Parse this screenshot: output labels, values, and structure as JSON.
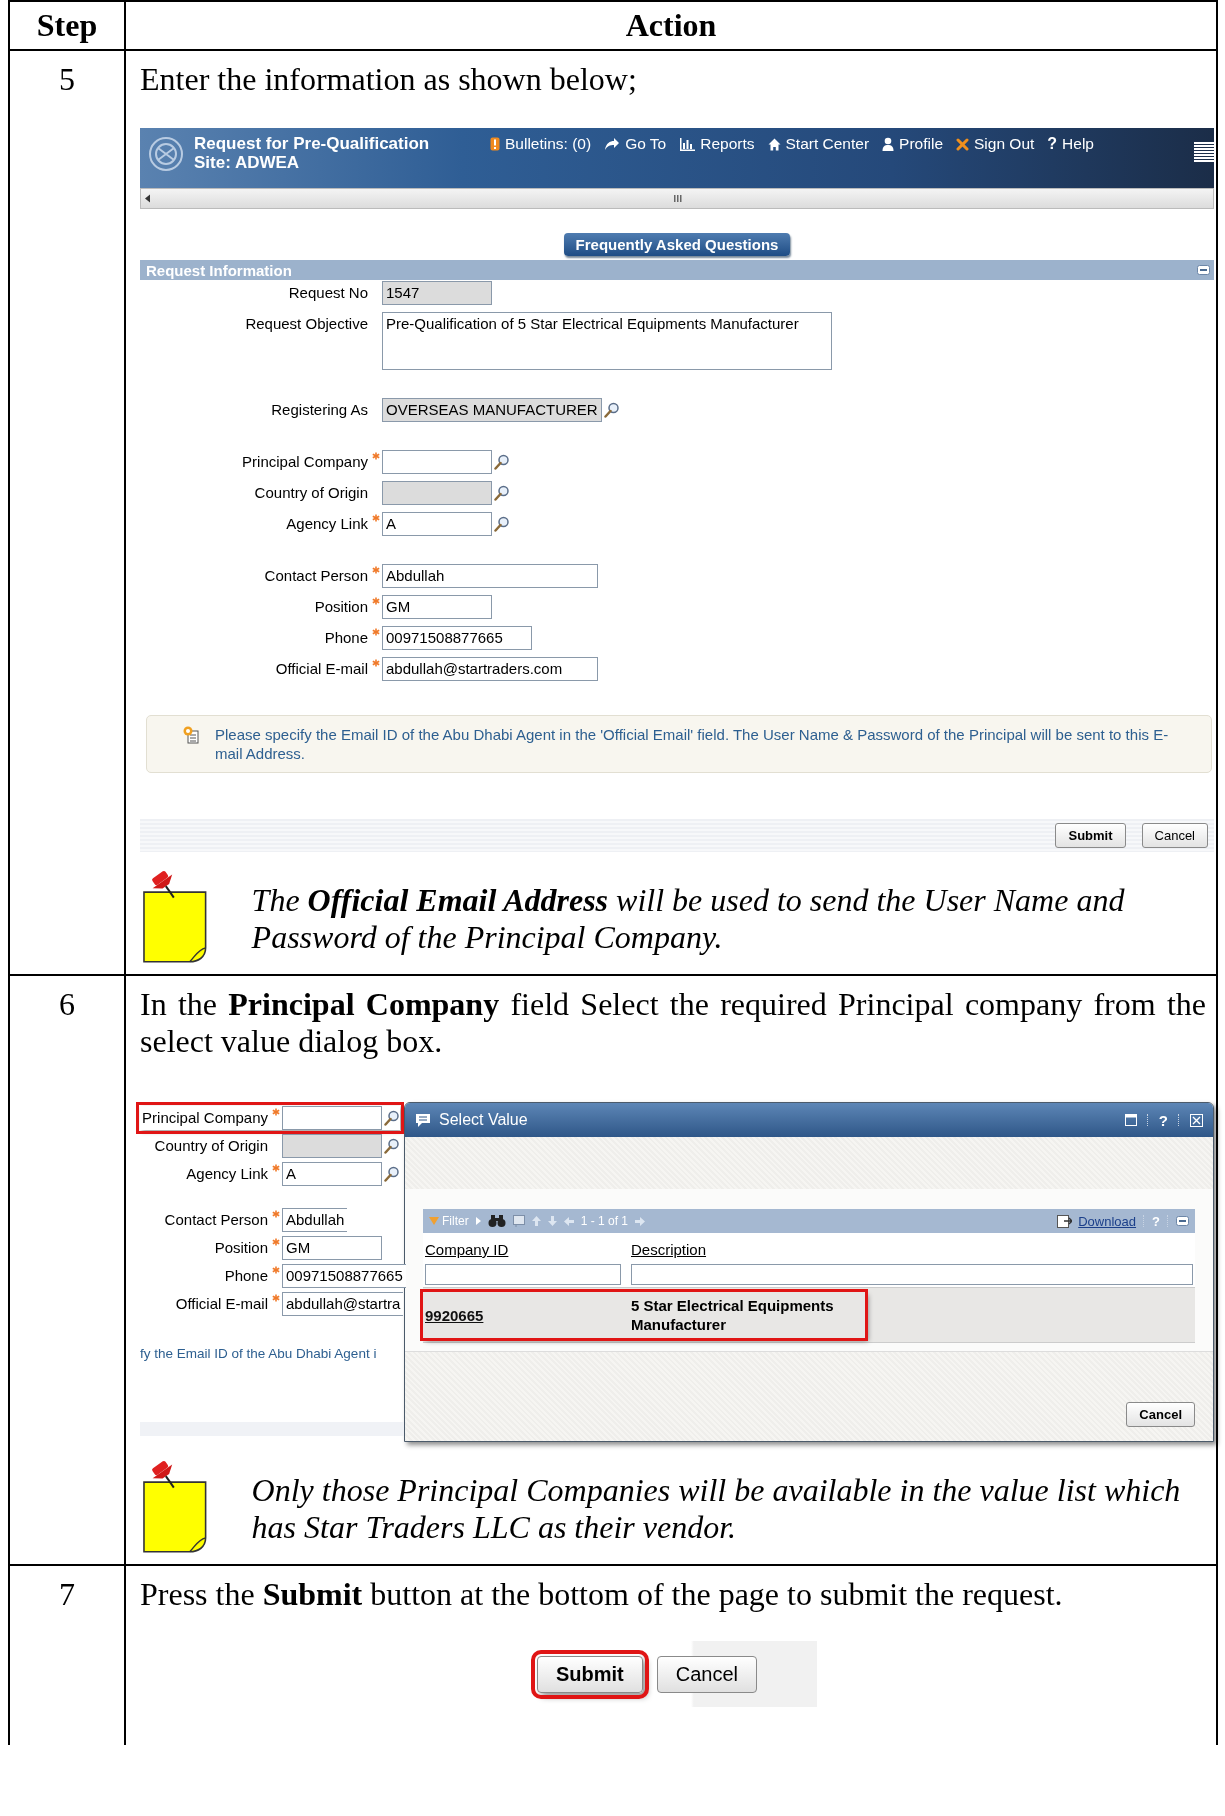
{
  "columns": [
    "Step",
    "Action"
  ],
  "steps": [
    {
      "number": "5",
      "instruction": "Enter the information as shown below;",
      "screenshot": {
        "kind": "form",
        "app_bar": {
          "title": "Request for Pre-Qualification",
          "site": "Site: ADWEA",
          "links": [
            {
              "label": "Bulletins: (0)"
            },
            {
              "label": "Go To"
            },
            {
              "label": "Reports"
            },
            {
              "label": "Start Center"
            },
            {
              "label": "Profile"
            },
            {
              "label": "Sign Out"
            },
            {
              "label": "Help",
              "glyph": "?"
            }
          ]
        },
        "faq_button": "Frequently Asked Questions",
        "section_title": "Request Information",
        "field_groups": [
          [
            {
              "label": "Request No",
              "value": "1547",
              "kind": "readonly",
              "required": false,
              "lookup": false
            },
            {
              "label": "Request Objective",
              "value": "Pre-Qualification of 5 Star Electrical Equipments Manufacturer",
              "kind": "textarea",
              "required": false,
              "lookup": false
            }
          ],
          [
            {
              "label": "Registering As",
              "value": "OVERSEAS MANUFACTURER",
              "kind": "readonly",
              "required": false,
              "lookup": true
            }
          ],
          [
            {
              "label": "Principal Company",
              "kind": "text",
              "required": true,
              "lookup": true
            },
            {
              "label": "Country of Origin",
              "kind": "readonly",
              "required": false,
              "lookup": true
            },
            {
              "label": "Agency Link",
              "value": "A",
              "kind": "text",
              "required": true,
              "lookup": true
            }
          ],
          [
            {
              "label": "Contact Person",
              "value": "Abdullah",
              "kind": "text",
              "required": true,
              "lookup": false
            },
            {
              "label": "Position",
              "value": "GM",
              "kind": "text",
              "required": true,
              "lookup": false
            },
            {
              "label": "Phone",
              "value": "00971508877665",
              "kind": "text",
              "required": true,
              "lookup": false
            },
            {
              "label": "Official E-mail",
              "value": "abdullah@startraders.com",
              "kind": "text",
              "required": true,
              "lookup": false
            }
          ]
        ],
        "info_message": "Please specify the Email ID of the Abu Dhabi Agent in the 'Official Email' field. The User Name & Password of the Principal will be sent to this E-mail Address.",
        "buttons": [
          "Submit",
          "Cancel"
        ]
      },
      "note": "The **Official Email Address** will be used to send the User Name and Password of the Principal Company."
    },
    {
      "number": "6",
      "instruction": "In the **Principal Company** field Select the required Principal company from the select value dialog box.",
      "screenshot": {
        "kind": "lookup",
        "background_fields": [
          {
            "label": "Principal Company",
            "kind": "text",
            "required": true,
            "lookup": true,
            "highlighted": true
          },
          {
            "label": "Country of Origin",
            "kind": "readonly",
            "required": false,
            "lookup": true,
            "highlighted": false
          },
          {
            "label": "Agency Link",
            "value": "A",
            "kind": "text",
            "required": true,
            "lookup": true,
            "highlighted": false
          },
          {
            "label": "Contact Person",
            "value": "Abdullah",
            "kind": "text",
            "required": true,
            "lookup": false,
            "highlighted": false
          },
          {
            "label": "Position",
            "value": "GM",
            "kind": "text",
            "required": true,
            "lookup": false,
            "highlighted": false
          },
          {
            "label": "Phone",
            "value": "00971508877665",
            "kind": "text",
            "required": true,
            "lookup": false,
            "highlighted": false
          },
          {
            "label": "Official E-mail",
            "value": "abdullah@startra",
            "kind": "text",
            "required": true,
            "lookup": false,
            "highlighted": false
          }
        ],
        "background_message": "fy the Email ID of the Abu Dhabi Agent i",
        "dialog": {
          "title": "Select Value",
          "title_help": "?",
          "filter": "Filter",
          "paging": "1 - 1 of 1",
          "download": "Download",
          "toolbar_help": "?",
          "columns": [
            "Company ID",
            "Description"
          ],
          "rows": [
            {
              "company_id": "9920665",
              "description": "5 Star Electrical Equipments Manufacturer",
              "highlighted": true
            }
          ],
          "buttons": [
            "Cancel"
          ]
        }
      },
      "note": "Only those Principal Companies will be available in the value list which has Star Traders LLC as their vendor."
    },
    {
      "number": "7",
      "instruction": "Press the **Submit** button at the bottom of the page to submit the request.",
      "screenshot": {
        "kind": "buttons",
        "buttons": [
          {
            "label": "Submit",
            "highlighted": true
          },
          {
            "label": "Cancel",
            "highlighted": false
          }
        ]
      }
    }
  ]
}
